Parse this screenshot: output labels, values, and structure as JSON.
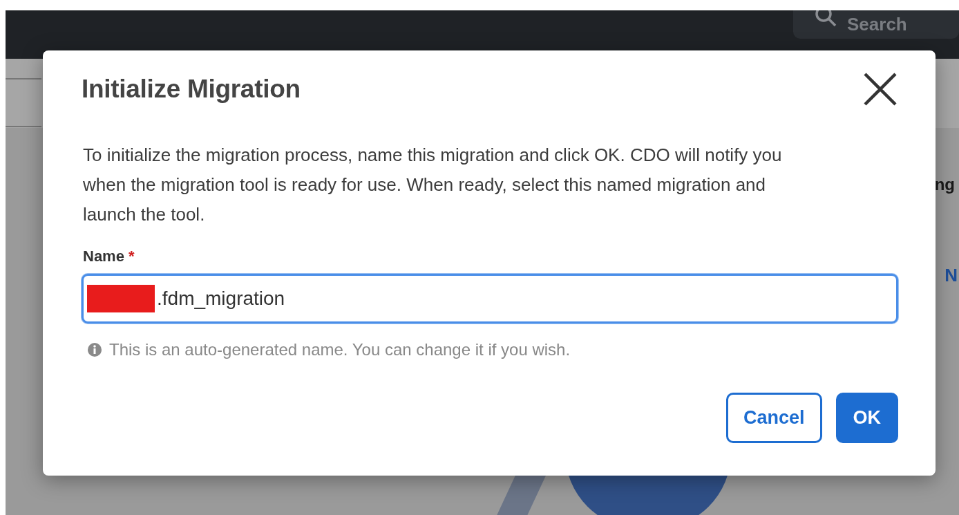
{
  "header": {
    "search": {
      "placeholder": "Search"
    }
  },
  "background": {
    "texts": [
      "ng",
      "N"
    ]
  },
  "dialog": {
    "title": "Initialize Migration",
    "description": "To initialize the migration process, name this migration and click OK. CDO will notify you when the migration tool is ready for use. When ready, select this named migration and launch the tool.",
    "field": {
      "label": "Name",
      "required_mark": "*",
      "value": ".fdm_migration",
      "focused": true,
      "hint": "This is an auto-generated name. You can change it if you wish."
    },
    "buttons": [
      {
        "label": "Cancel",
        "kind": "secondary"
      },
      {
        "label": "OK",
        "kind": "primary"
      }
    ]
  }
}
